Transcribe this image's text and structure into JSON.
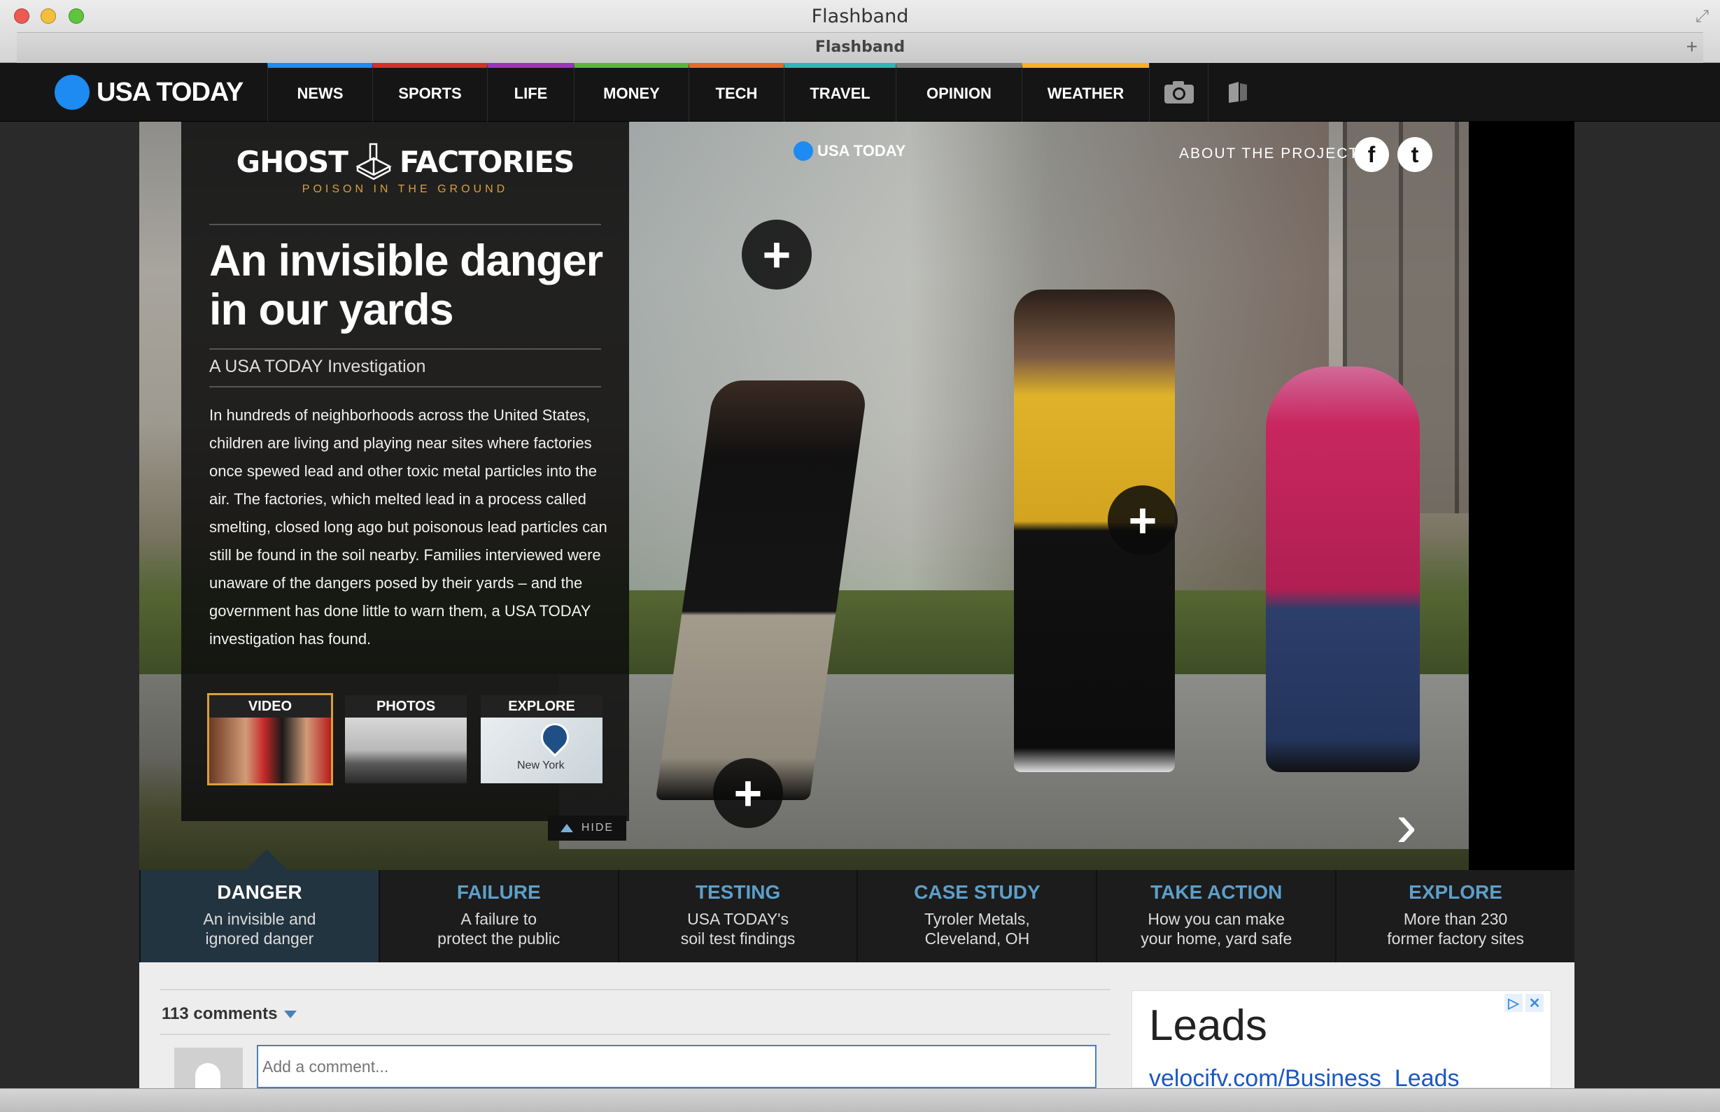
{
  "window": {
    "title": "Flashband",
    "tab_title": "Flashband"
  },
  "nav": {
    "logo_text": "USA TODAY",
    "items": [
      {
        "label": "NEWS",
        "color": "#1d8bf1",
        "width": 150
      },
      {
        "label": "SPORTS",
        "color": "#d3302a",
        "width": 164
      },
      {
        "label": "LIFE",
        "color": "#9b36b7",
        "width": 124
      },
      {
        "label": "MONEY",
        "color": "#5fb33b",
        "width": 164
      },
      {
        "label": "TECH",
        "color": "#e86a27",
        "width": 136
      },
      {
        "label": "TRAVEL",
        "color": "#2fb6b6",
        "width": 160
      },
      {
        "label": "OPINION",
        "color": "#7f7f7f",
        "width": 180
      },
      {
        "label": "WEATHER",
        "color": "#f2b325",
        "width": 182
      }
    ],
    "camera_icon": "camera-icon",
    "reader_icon": "reader-icon"
  },
  "hero": {
    "brand_left": "GHOST",
    "brand_right": "FACTORIES",
    "brand_sub": "POISON IN THE GROUND",
    "headline": "An invisible danger in our yards",
    "kicker": "A USA TODAY Investigation",
    "body": "In hundreds of neighborhoods across the United States, children are living and playing near sites where factories once spewed lead and other toxic metal particles into the air. The factories, which melted lead in a process called smelting, closed long ago but poisonous lead particles can still be found in the soil nearby. Families interviewed were unaware of the dangers posed by their yards – and the government has done little to warn them, a USA TODAY investigation has found.",
    "thumbs": [
      {
        "label": "VIDEO"
      },
      {
        "label": "PHOTOS"
      },
      {
        "label": "EXPLORE",
        "map_text": "New York"
      }
    ],
    "hide_label": "HIDE",
    "photo_logo": "USA TODAY",
    "about_label": "ABOUT THE PROJECT",
    "facebook_icon": "f",
    "twitter_icon": "t",
    "plus_symbol": "+",
    "next_symbol": "›"
  },
  "sections": [
    {
      "title": "DANGER",
      "desc1": "An invisible and",
      "desc2": "ignored danger"
    },
    {
      "title": "FAILURE",
      "desc1": "A failure to",
      "desc2": "protect the public"
    },
    {
      "title": "TESTING",
      "desc1": "USA TODAY's",
      "desc2": "soil test findings"
    },
    {
      "title": "CASE STUDY",
      "desc1": "Tyroler Metals,",
      "desc2": "Cleveland, OH"
    },
    {
      "title": "TAKE ACTION",
      "desc1": "How you can make",
      "desc2": "your home, yard safe"
    },
    {
      "title": "EXPLORE",
      "desc1": "More than 230",
      "desc2": "former factory sites"
    }
  ],
  "comments": {
    "count": "113 comments",
    "placeholder": "Add a comment..."
  },
  "ad": {
    "title": "Leads",
    "link": "velocifv.com/Business_Leads",
    "choices_icon": "▷",
    "close_icon": "✕"
  }
}
